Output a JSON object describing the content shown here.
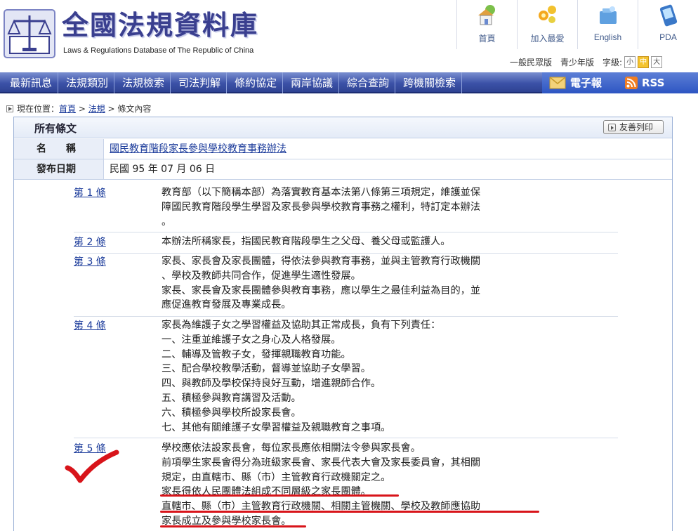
{
  "site": {
    "title": "全國法規資料庫",
    "subtitle": "Laws & Regulations Database of The Republic of China"
  },
  "topnav": [
    {
      "label": "首頁",
      "icon": "home-icon"
    },
    {
      "label": "加入最愛",
      "icon": "favorite-icon"
    },
    {
      "label": "English",
      "icon": "english-icon"
    },
    {
      "label": "PDA",
      "icon": "pda-icon"
    }
  ],
  "subnav": {
    "general": "一般民眾版",
    "youth": "青少年版",
    "fontsize_label": "字級:",
    "font_small": "小",
    "font_medium": "中",
    "font_large": "大"
  },
  "mainnav": [
    "最新訊息",
    "法規類別",
    "法規檢索",
    "司法判解",
    "條約協定",
    "兩岸協議",
    "綜合查詢",
    "跨機關檢索"
  ],
  "mainnav_right": {
    "epaper": "電子報",
    "rss": "RSS"
  },
  "breadcrumb": {
    "prefix": "現在位置：",
    "home": "首頁",
    "sep1": " > ",
    "laws": "法規",
    "sep2": " > ",
    "current": "條文內容"
  },
  "panel": {
    "title": "所有條文",
    "print_button": "友善列印",
    "name_label": "名　　稱",
    "name_value": "國民教育階段家長參與學校教育事務辦法",
    "date_label": "發布日期",
    "date_value": "民國 95 年 07 月 06 日"
  },
  "articles": [
    {
      "no": "第 1 條",
      "lines": [
        "教育部（以下簡稱本部）為落實教育基本法第八條第三項規定，維護並保",
        "障國民教育階段學生學習及家長參與學校教育事務之權利，特訂定本辦法",
        "。"
      ]
    },
    {
      "no": "第 2 條",
      "lines": [
        "本辦法所稱家長，指國民教育階段學生之父母、養父母或監護人。"
      ]
    },
    {
      "no": "第 3 條",
      "lines": [
        "家長、家長會及家長團體，得依法參與教育事務，並與主管教育行政機關",
        "、學校及教師共同合作，促進學生適性發展。",
        "家長、家長會及家長團體參與教育事務，應以學生之最佳利益為目的，並",
        "應促進教育發展及專業成長。"
      ]
    },
    {
      "no": "第 4 條",
      "lines": [
        "家長為維護子女之學習權益及協助其正常成長，負有下列責任：",
        "一、注重並維護子女之身心及人格發展。",
        "二、輔導及管教子女，發揮親職教育功能。",
        "三、配合學校教學活動，督導並協助子女學習。",
        "四、與教師及學校保持良好互動，增進親師合作。",
        "五、積極參與教育講習及活動。",
        "六、積極參與學校所設家長會。",
        "七、其他有關維護子女學習權益及親職教育之事項。"
      ]
    },
    {
      "no": "第 5 條",
      "lines": [
        "學校應依法設家長會，每位家長應依相關法令參與家長會。",
        "前項學生家長會得分為班級家長會、家長代表大會及家長委員會，其相關",
        "規定，由直轄市、縣（市）主管教育行政機關定之。",
        "家長得依人民團體法組成不同層級之家長團體。",
        "直轄市、縣（市）主管教育行政機關、相關主管機關、學校及教師應協助",
        "家長成立及參與學校家長會。"
      ]
    }
  ],
  "colors": {
    "nav_blue": "#3c52a8",
    "link_blue": "#1a3a9a",
    "annotation_red": "#d8141a"
  }
}
